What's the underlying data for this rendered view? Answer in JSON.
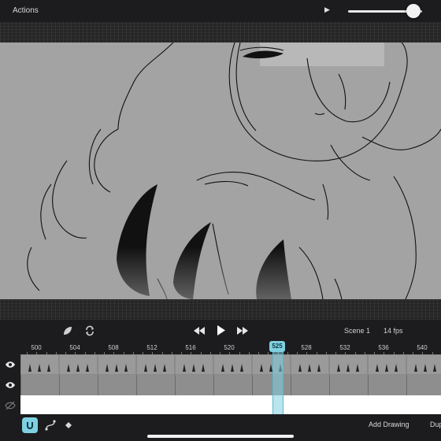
{
  "topbar": {
    "actions_label": "Actions",
    "play_icon": "play-icon",
    "opacity_slider_value": 0.88
  },
  "controls": {
    "scene_label": "Scene 1",
    "fps_label": "14 fps",
    "icons": [
      "onion-skin-icon",
      "loop-icon",
      "rewind-icon",
      "play-icon",
      "fast-forward-icon"
    ]
  },
  "timeline": {
    "frame_labels": [
      "500",
      "504",
      "508",
      "512",
      "516",
      "520",
      "525",
      "528",
      "532",
      "536",
      "540"
    ],
    "current_frame": "525",
    "accent_color": "#7fd0e0"
  },
  "layers": [
    {
      "visible": true,
      "icon": "eye-icon"
    },
    {
      "visible": true,
      "icon": "eye-icon"
    },
    {
      "visible": false,
      "icon": "eye-hidden-icon"
    }
  ],
  "bottombar": {
    "tools": [
      "magnet-icon",
      "path-icon",
      "keyframe-icon"
    ],
    "add_drawing_label": "Add Drawing",
    "duplicate_label": "Dup"
  }
}
